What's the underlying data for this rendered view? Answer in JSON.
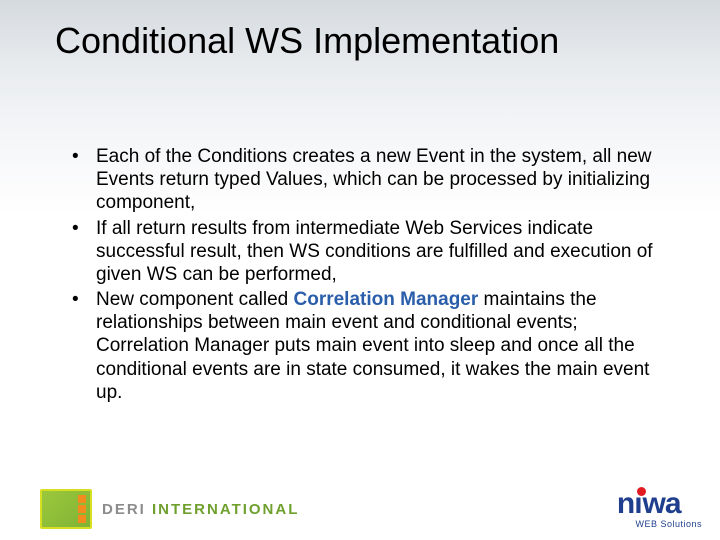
{
  "title": "Conditional WS Implementation",
  "bullets": [
    {
      "pre": "Each of the Conditions creates a new Event in the system, all new Events return typed Values, which can be processed by initializing component,",
      "highlight": "",
      "post": ""
    },
    {
      "pre": "If all return results from intermediate Web Services indicate successful result, then WS conditions are fulfilled and execution of given WS can be performed,",
      "highlight": "",
      "post": ""
    },
    {
      "pre": "New component called ",
      "highlight": "Correlation Manager",
      "post": " maintains the relationships between main event and conditional events; Correlation Manager puts main event into sleep and once all the conditional events are in state consumed, it wakes the main event up."
    }
  ],
  "footer": {
    "deri_label_1": "DERI",
    "deri_label_2": " INTERNATIONAL",
    "niwa_n": "n",
    "niwa_i": "ı",
    "niwa_wa": "wa",
    "niwa_sub": "WEB Solutions"
  }
}
